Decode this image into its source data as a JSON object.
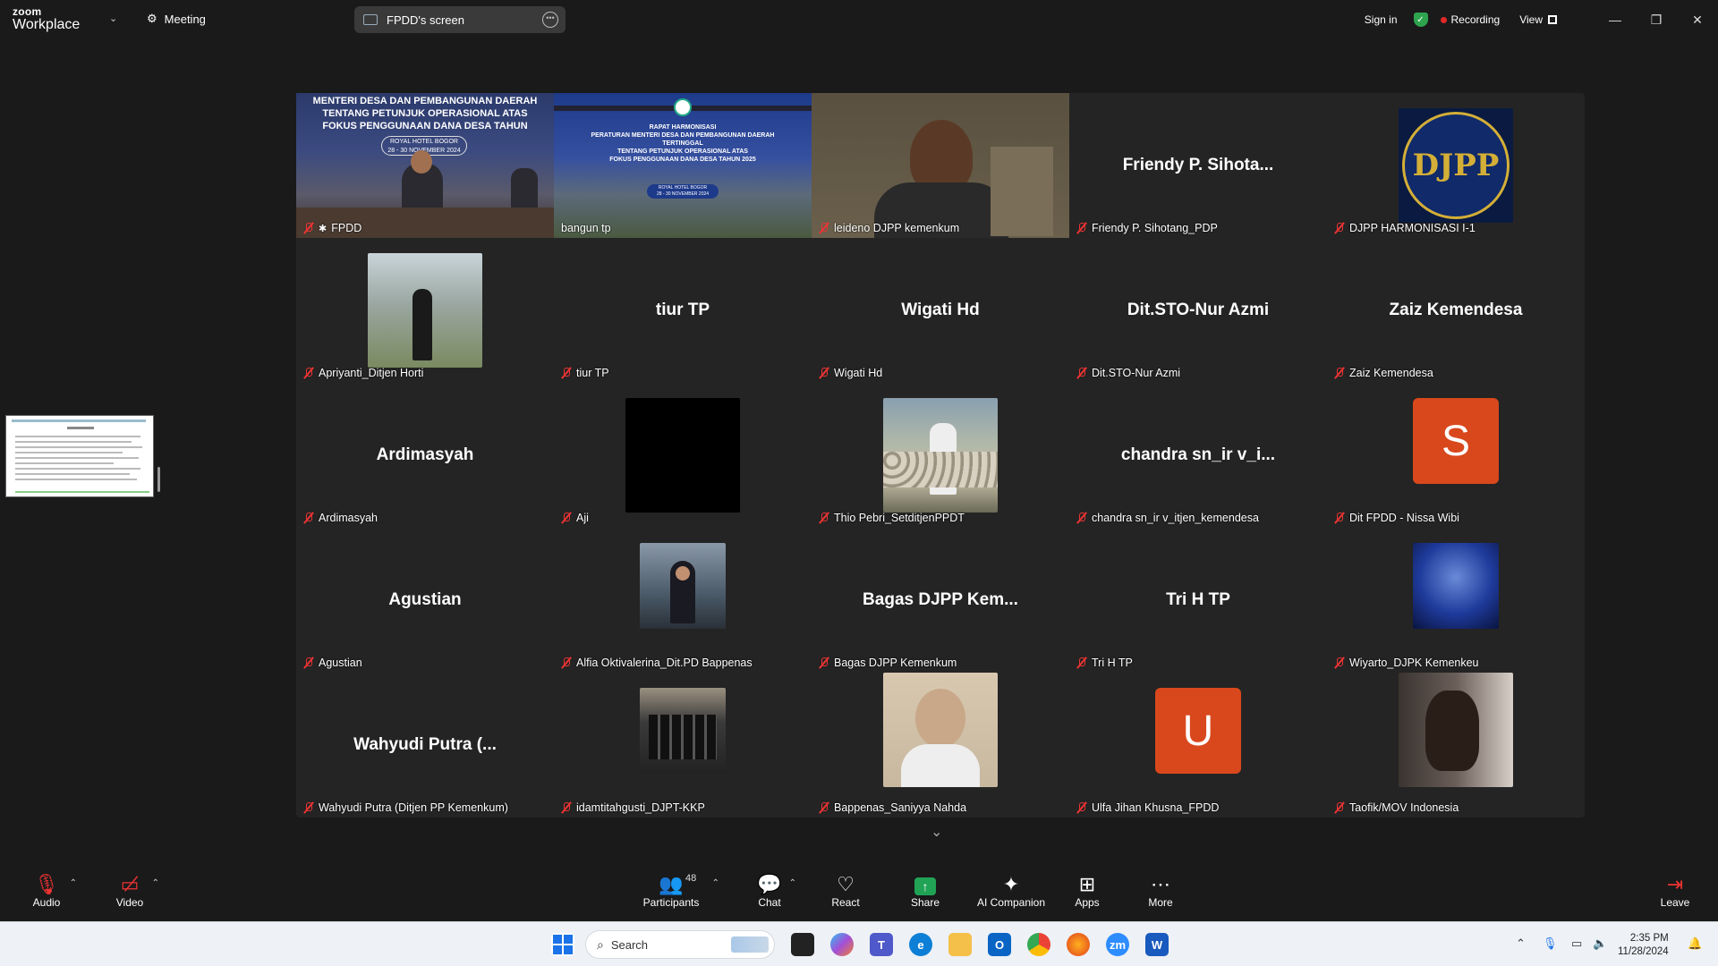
{
  "app": {
    "logo_top": "zoom",
    "logo_bottom": "Workplace",
    "meeting_label": "Meeting",
    "share_pill_label": "FPDD's screen",
    "sign_in": "Sign in",
    "recording": "Recording",
    "view": "View"
  },
  "tiles": [
    {
      "label": "FPDD"
    },
    {
      "label": "bangun tp"
    },
    {
      "label": "leideno DJPP kemenkum"
    },
    {
      "label": "Friendy P. Sihotang_PDP",
      "big": "Friendy P. Sihota..."
    },
    {
      "label": "DJPP HARMONISASI I-1",
      "logo_text": "DJPP"
    },
    {
      "label": "Apriyanti_Ditjen Horti"
    },
    {
      "label": "tiur TP",
      "big": "tiur TP"
    },
    {
      "label": "Wigati Hd",
      "big": "Wigati Hd"
    },
    {
      "label": "Dit.STO-Nur Azmi",
      "big": "Dit.STO-Nur Azmi"
    },
    {
      "label": "Zaiz Kemendesa",
      "big": "Zaiz Kemendesa"
    },
    {
      "label": "Ardimasyah",
      "big": "Ardimasyah"
    },
    {
      "label": "Aji"
    },
    {
      "label": "Thio Pebri_SetditjenPPDT"
    },
    {
      "label": "chandra sn_ir v_itjen_kemendesa",
      "big": "chandra sn_ir v_i..."
    },
    {
      "label": "Dit FPDD - Nissa Wibi",
      "letter": "S"
    },
    {
      "label": "Agustian",
      "big": "Agustian"
    },
    {
      "label": "Alfia Oktivalerina_Dit.PD Bappenas"
    },
    {
      "label": "Bagas DJPP Kemenkum",
      "big": "Bagas DJPP Kem..."
    },
    {
      "label": "Tri H TP",
      "big": "Tri H TP"
    },
    {
      "label": "Wiyarto_DJPK Kemenkeu"
    },
    {
      "label": "Wahyudi Putra (Ditjen PP Kemenkum)",
      "big": "Wahyudi Putra (..."
    },
    {
      "label": "idamtitahgusti_DJPT-KKP"
    },
    {
      "label": "Bappenas_Saniyya Nahda"
    },
    {
      "label": "Ulfa Jihan Khusna_FPDD",
      "letter": "U"
    },
    {
      "label": "Taofik/MOV Indonesia"
    }
  ],
  "slide": {
    "line1": "MENTERI DESA DAN PEMBANGUNAN DAERAH",
    "line2": "TENTANG PETUNJUK OPERASIONAL ATAS",
    "line3": "FOKUS PENGGUNAAN DANA DESA TAHUN",
    "venue": "ROYAL HOTEL BOGOR",
    "dates": "28 - 30 NOVEMBER 2024"
  },
  "slide2": {
    "title": "RAPAT HARMONISASI",
    "l1": "PERATURAN MENTERI DESA DAN PEMBANGUNAN DAERAH",
    "l2": "TERTINGGAL",
    "l3": "TENTANG PETUNJUK OPERASIONAL ATAS",
    "l4": "FOKUS PENGGUNAAN DANA DESA TAHUN 2025",
    "venue": "ROYAL HOTEL BOGOR",
    "dates": "28 - 30 NOVEMBER 2024"
  },
  "toolbar": {
    "audio": "Audio",
    "video": "Video",
    "participants": "Participants",
    "participants_count": "48",
    "chat": "Chat",
    "react": "React",
    "share": "Share",
    "ai": "AI Companion",
    "apps": "Apps",
    "more": "More",
    "leave": "Leave"
  },
  "taskbar": {
    "search": "Search",
    "time": "2:35 PM",
    "date": "11/28/2024"
  },
  "colors": {
    "accent_green": "#22c55e",
    "recording_red": "#e02828",
    "avatar_orange": "#d9481c"
  }
}
